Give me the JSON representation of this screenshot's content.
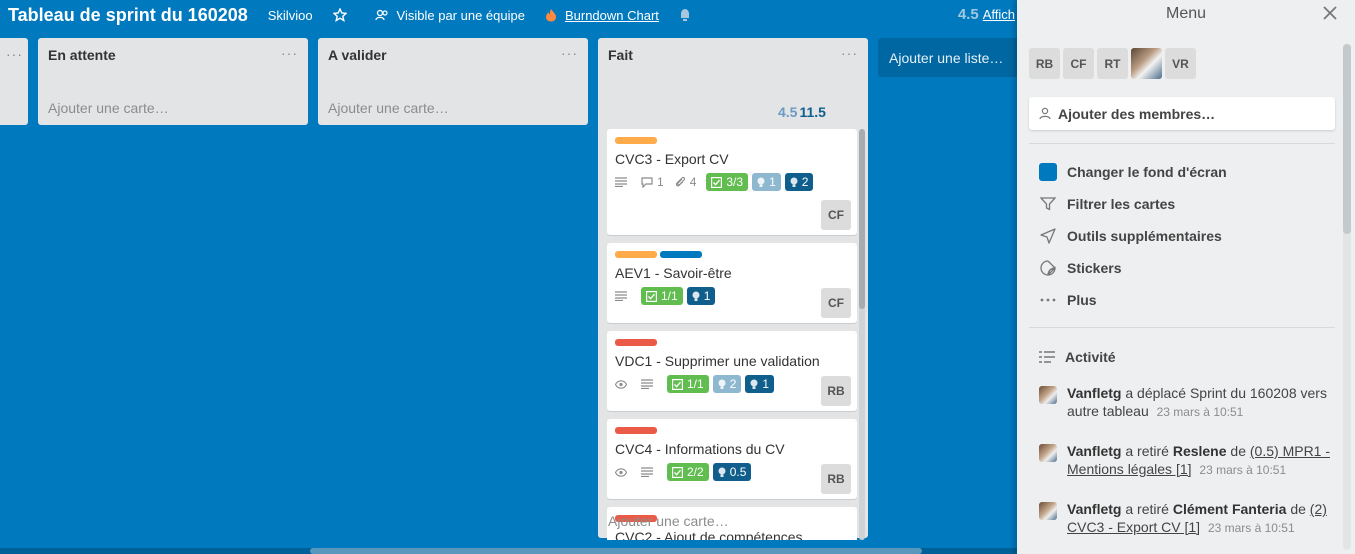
{
  "header": {
    "board_title": "Tableau de sprint du 160208",
    "team": "Skilvioo",
    "visibility": "Visible par une équipe",
    "burndown": "Burndown Chart",
    "total_estimated": "4.5",
    "total_real": "11.5",
    "show_menu": "Affich"
  },
  "lists": [
    {
      "title": "En attente",
      "menu": "...",
      "add_card": "Ajouter une carte…"
    },
    {
      "title": "A valider",
      "menu": "...",
      "add_card": "Ajouter une carte…"
    },
    {
      "title": "Fait",
      "menu": "...",
      "estimated_points": "4.5",
      "real_points": "11.5",
      "add_card": "Ajouter une carte…",
      "cards": [
        {
          "title": "CVC3 - Export CV",
          "labels": [
            "#ffab4a"
          ],
          "comments": "1",
          "attachments": "4",
          "checklist": "3/3",
          "estimate": "1",
          "real": "2",
          "member": "CF"
        },
        {
          "title": "AEV1 - Savoir-être",
          "labels": [
            "#ffab4a",
            "#0079bf"
          ],
          "checklist": "1/1",
          "real": "1",
          "member": "CF"
        },
        {
          "title": "VDC1 - Supprimer une validation",
          "labels": [
            "#eb5a46"
          ],
          "checklist": "1/1",
          "estimate": "2",
          "real": "1",
          "member": "RB"
        },
        {
          "title": "CVC4 - Informations du CV",
          "labels": [
            "#eb5a46"
          ],
          "checklist": "2/2",
          "real": "0.5",
          "member": "RB"
        },
        {
          "title": "CVC2 - Ajout de compétences",
          "labels": [
            "#eb5a46"
          ]
        }
      ]
    }
  ],
  "add_list": "Ajouter une liste…",
  "menu": {
    "title": "Menu",
    "members": [
      "RB",
      "CF",
      "RT",
      "",
      "VR"
    ],
    "add_members": "Ajouter des membres…",
    "items": [
      {
        "label": "Changer le fond d'écran",
        "icon": "background-swatch-icon"
      },
      {
        "label": "Filtrer les cartes",
        "icon": "filter-icon"
      },
      {
        "label": "Outils supplémentaires",
        "icon": "rocket-icon"
      },
      {
        "label": "Stickers",
        "icon": "sticker-icon"
      },
      {
        "label": "Plus",
        "icon": "more-icon"
      }
    ],
    "activity_title": "Activité",
    "activity": [
      {
        "user": "Vanfletg",
        "action": "a déplacé Sprint du 160208 vers autre tableau",
        "time": "23 mars à 10:51"
      },
      {
        "user": "Vanfletg",
        "action": "a retiré",
        "target": "Reslene",
        "prep": "de",
        "link": "(0.5) MPR1 - Mentions légales [1]",
        "time": "23 mars à 10:51"
      },
      {
        "user": "Vanfletg",
        "action": "a retiré",
        "target": "Clément Fanteria",
        "prep": "de",
        "link": "(2) CVC3 - Export CV [1]",
        "time": "23 mars à 10:51"
      }
    ]
  }
}
